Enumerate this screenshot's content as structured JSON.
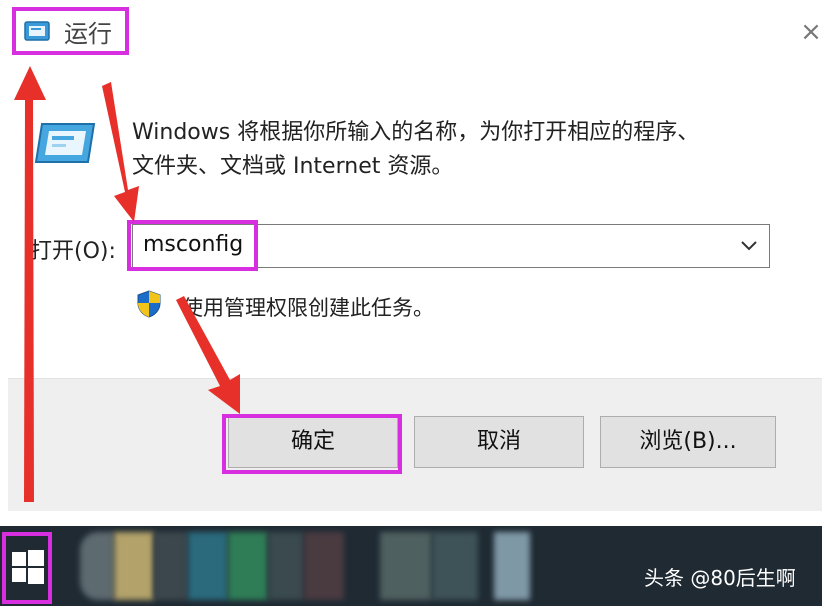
{
  "window": {
    "title": "运行",
    "close_label": "×"
  },
  "description": {
    "line1": "Windows 将根据你所输入的名称，为你打开相应的程序、",
    "line2": "文件夹、文档或 Internet 资源。"
  },
  "open_field": {
    "label": "打开(O):",
    "value": "msconfig"
  },
  "admin_note": "使用管理权限创建此任务。",
  "buttons": {
    "ok": "确定",
    "cancel": "取消",
    "browse": "浏览(B)..."
  },
  "watermark": "头条 @80后生啊",
  "colors": {
    "highlight": "#d72fe0",
    "arrow": "#e8302a",
    "taskbar": "#1f2a33"
  },
  "icons": [
    "run-icon",
    "close-icon",
    "chevron-down-icon",
    "uac-shield-icon",
    "windows-logo-icon"
  ]
}
